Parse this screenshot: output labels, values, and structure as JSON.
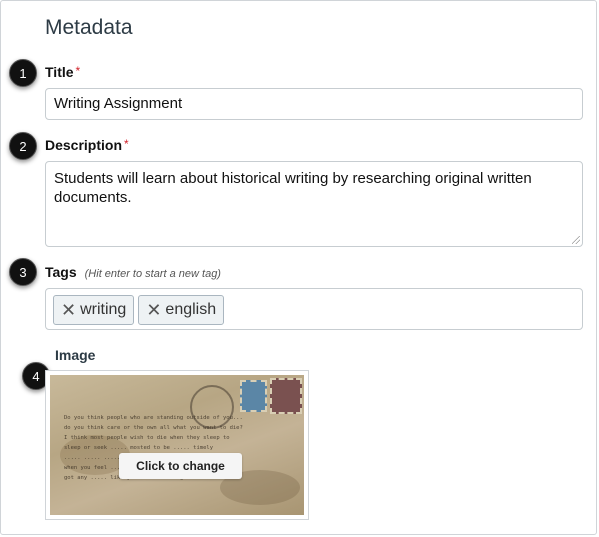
{
  "section": {
    "heading": "Metadata"
  },
  "callouts": [
    "1",
    "2",
    "3",
    "4"
  ],
  "title_field": {
    "label": "Title",
    "required_mark": "*",
    "value": "Writing Assignment"
  },
  "description_field": {
    "label": "Description",
    "required_mark": "*",
    "value": "Students will learn about historical writing by researching original written documents."
  },
  "tags_field": {
    "label": "Tags",
    "hint": "(Hit enter to start a new tag)",
    "remove_glyph": "✕",
    "tags": [
      "writing",
      "english"
    ]
  },
  "image_field": {
    "label": "Image",
    "change_label": "Click to change",
    "handwriting_lines": [
      "Do you think people who are standing outside of you...",
      "do you think care or the own all what you want to die?",
      "I think most people wish to die when they sleep to",
      "sleep or seek ..... mosted to be ..... timely",
      "..... ..... ..... ..... ..... ..... Last is",
      "when you feel ..... ..... ..... ..... ..... enough",
      "got any ..... like you've seen enough."
    ]
  }
}
